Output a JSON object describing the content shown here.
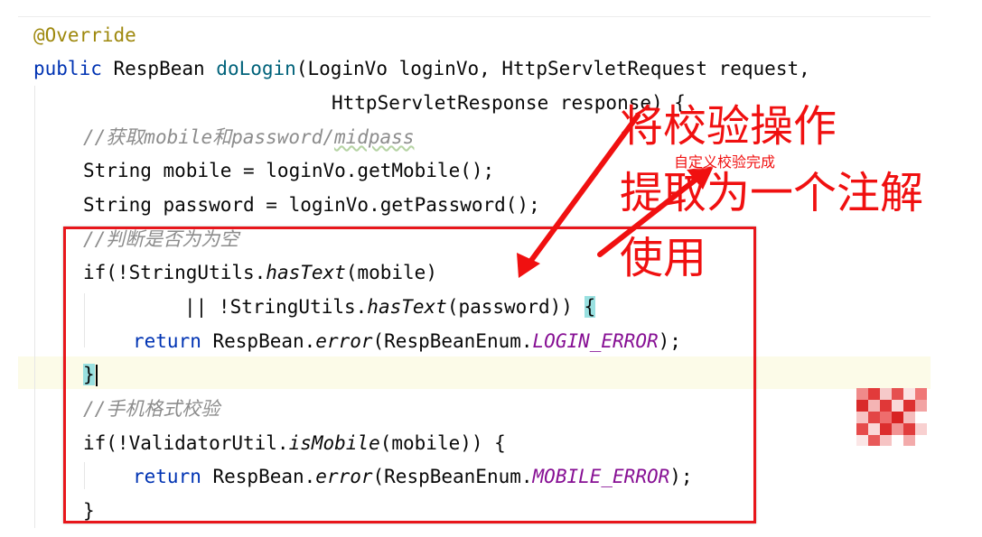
{
  "code": {
    "line1": {
      "annotation": "@Override"
    },
    "line2": {
      "kw_public": "public",
      "type": " RespBean ",
      "method": "doLogin",
      "params": "(LoginVo loginVo, HttpServletRequest request,"
    },
    "line3": {
      "text": "HttpServletResponse response) {"
    },
    "line4": {
      "prefix": "//获取",
      "mobile": "mobile",
      "mid1": "和",
      "password_word": "password",
      "sep": "/",
      "midpass": "midpass"
    },
    "line5": {
      "text": "String mobile = loginVo.getMobile();"
    },
    "line6": {
      "text": "String password = loginVo.getPassword();"
    },
    "line7": {
      "comment": "//判断是否为为空"
    },
    "line8": {
      "pre": "if(!StringUtils.",
      "call": "hasText",
      "post": "(mobile)"
    },
    "line9": {
      "pre": "|| !StringUtils.",
      "call": "hasText",
      "post": "(password)) ",
      "brace": "{"
    },
    "line10": {
      "kw": "return",
      "pre": " RespBean.",
      "call": "error",
      "mid": "(RespBeanEnum.",
      "const": "LOGIN_ERROR",
      "post": ");"
    },
    "line11": {
      "brace": "}"
    },
    "line12": {
      "comment": "//手机格式校验"
    },
    "line13": {
      "pre": "if(!ValidatorUtil.",
      "call": "isMobile",
      "post": "(mobile)) {"
    },
    "line14": {
      "kw": "return",
      "pre": " RespBean.",
      "call": "error",
      "mid": "(RespBeanEnum.",
      "const": "MOBILE_ERROR",
      "post": ");"
    },
    "line15": {
      "brace": "}"
    }
  },
  "annotations": {
    "big_line1": "将校验操作",
    "small": "自定义校验完成",
    "big_line2": "提取为一个注解",
    "big_line3": "使用"
  },
  "colors": {
    "keyword": "#0033b3",
    "annotation": "#9e880d",
    "method_declaration": "#00627a",
    "enum_constant": "#871094",
    "comment": "#8c8c8c",
    "markup_red": "#f01010",
    "brace_highlight": "#99e0e0"
  }
}
